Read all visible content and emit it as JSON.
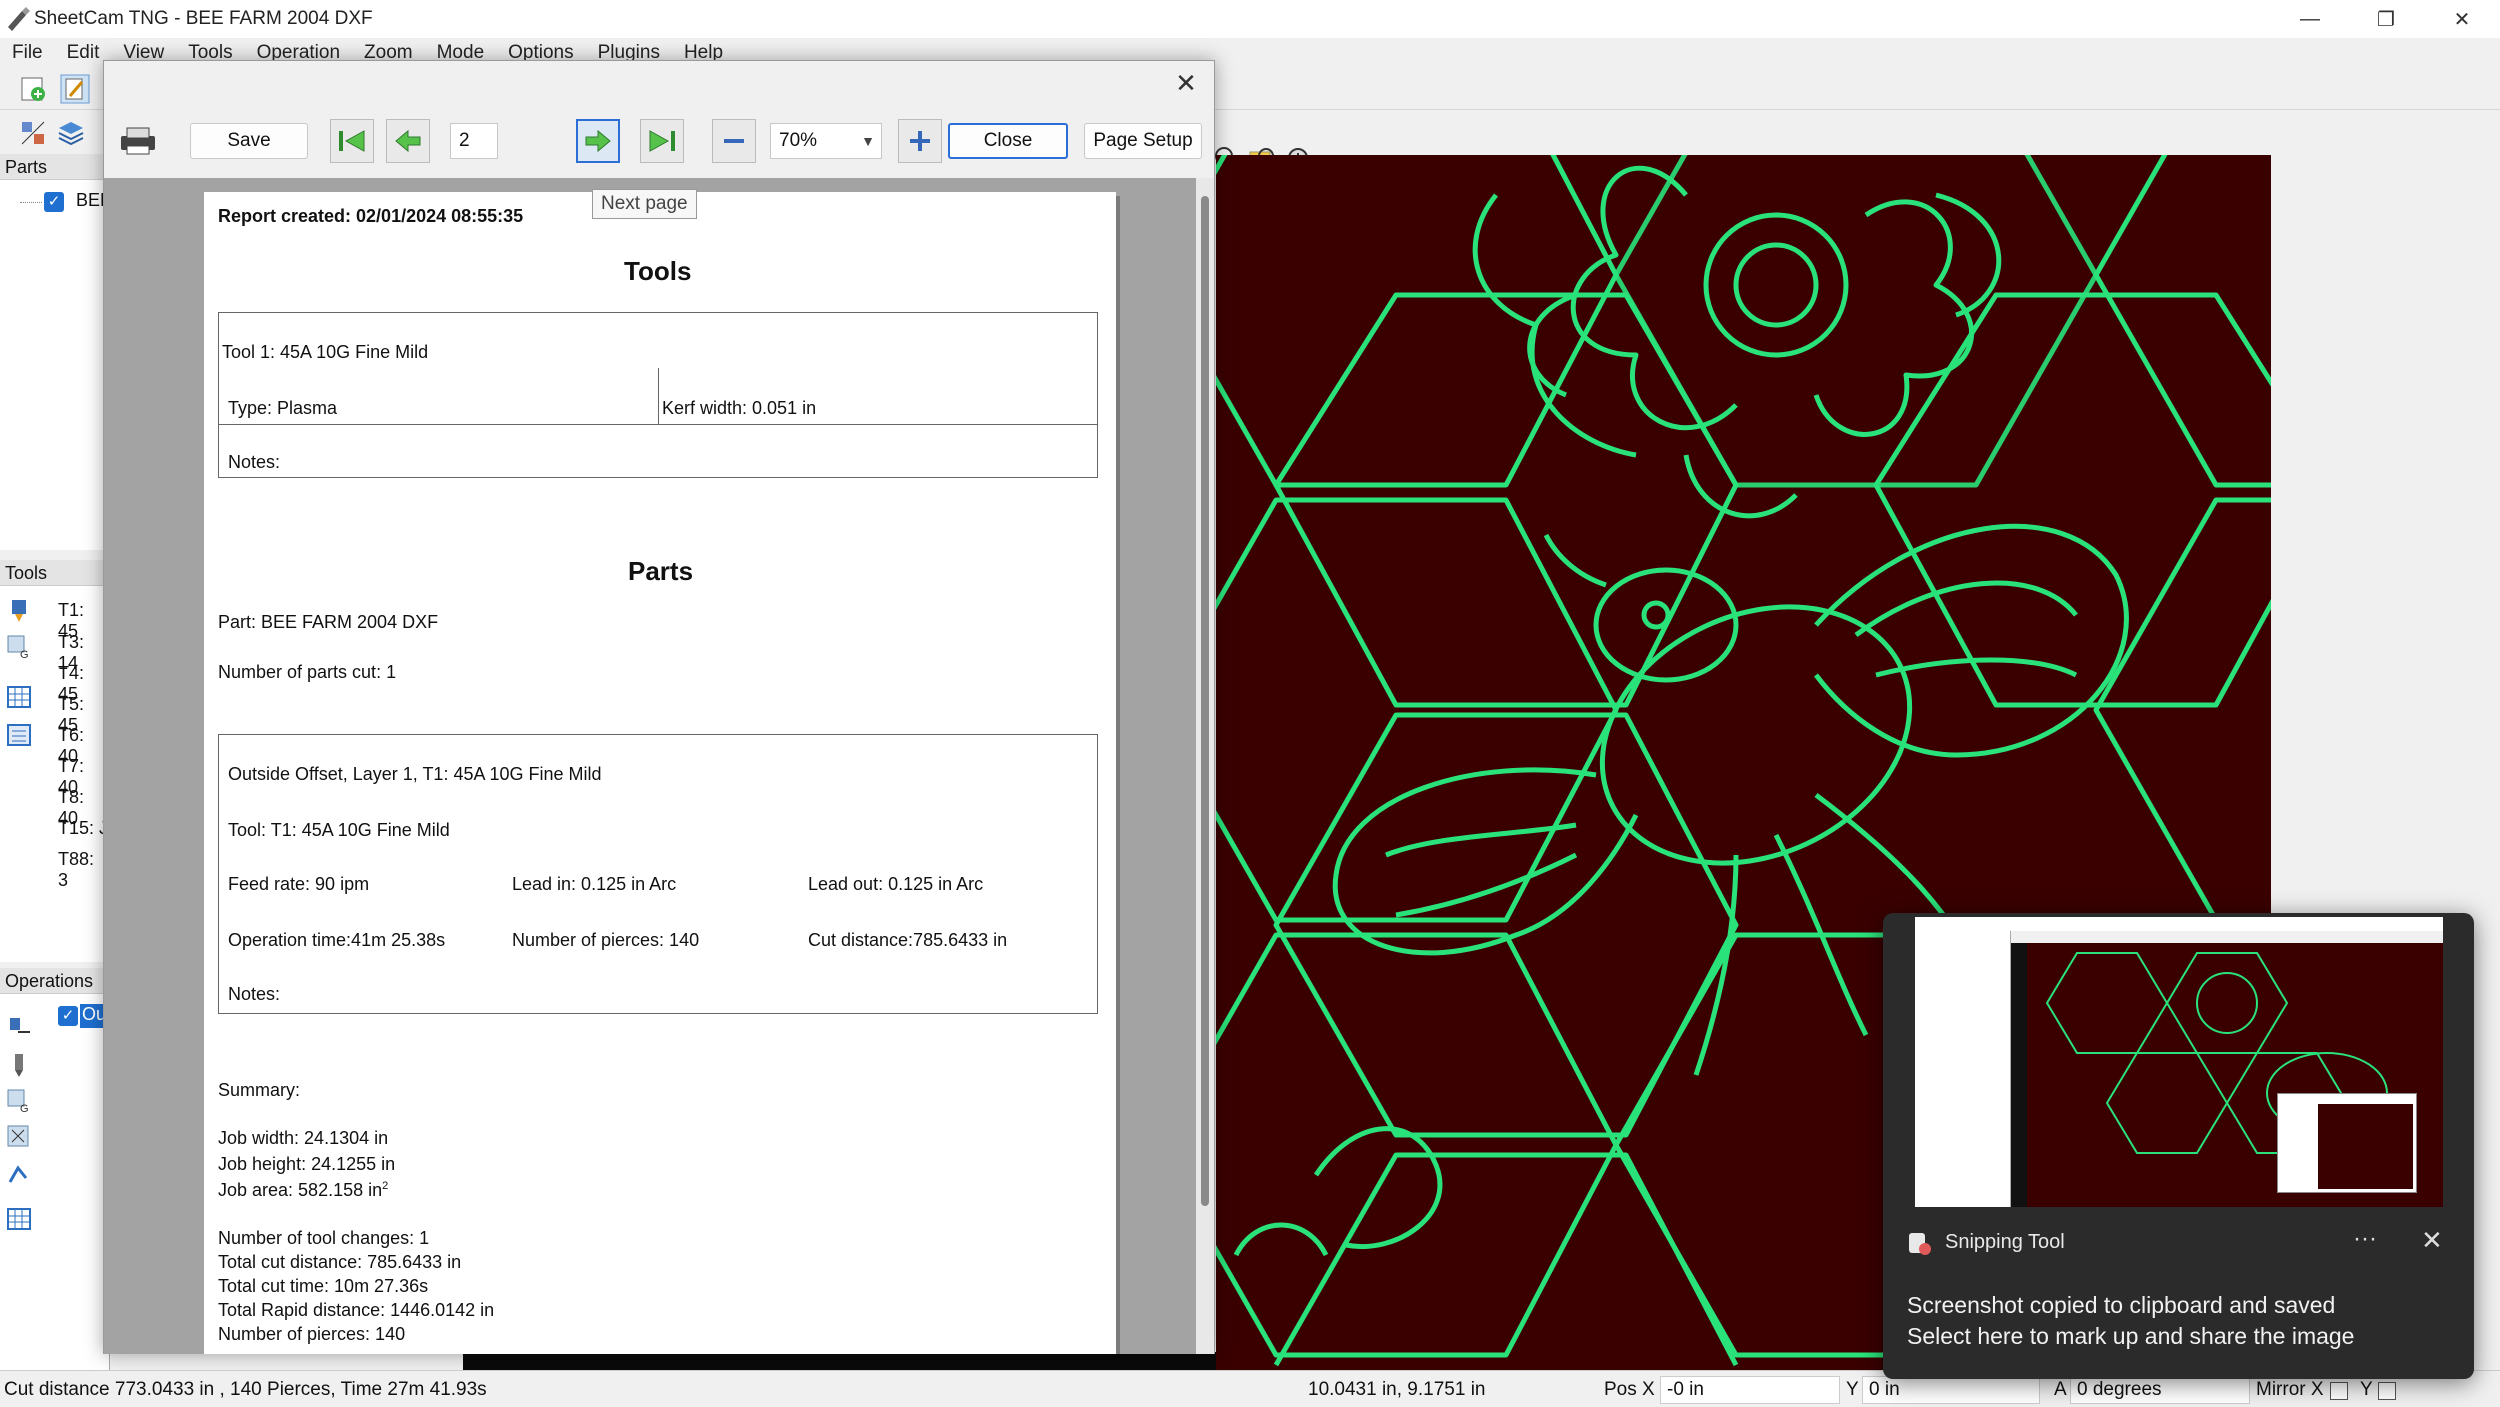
{
  "window": {
    "title": "SheetCam TNG - BEE FARM 2004 DXF",
    "min": "—",
    "max": "❐",
    "close": "✕"
  },
  "menu": [
    "File",
    "Edit",
    "View",
    "Tools",
    "Operation",
    "Zoom",
    "Mode",
    "Options",
    "Plugins",
    "Help"
  ],
  "panels": {
    "parts_title": "Parts",
    "parts_item": "BEE",
    "tools_title": "Tools",
    "tools": [
      "T1: 45",
      "T3: 14",
      "T4: 45",
      "T5: 45",
      "T6: 40",
      "T7: 40",
      "T8: 40",
      "T15: J",
      "T88: 3"
    ],
    "operations_title": "Operations",
    "operations_item": "Ou"
  },
  "dialog": {
    "save": "Save",
    "page": "2",
    "zoom": "70%",
    "close": "Close",
    "page_setup": "Page Setup",
    "tooltip": "Next page",
    "report_created": "Report created: 02/01/2024 08:55:35",
    "tools_heading": "Tools",
    "tool1": "Tool 1: 45A 10G Fine Mild",
    "type": "Type: Plasma",
    "kerf": "Kerf width: 0.051 in",
    "notes1": "Notes:",
    "parts_heading": "Parts",
    "part": "Part: BEE FARM 2004 DXF",
    "num_parts": "Number of parts cut: 1",
    "op_title": "Outside Offset, Layer 1, T1: 45A 10G Fine Mild",
    "op_tool": "Tool: T1: 45A 10G Fine Mild",
    "feed": "Feed rate: 90 ipm",
    "lead_in": "Lead in: 0.125 in Arc",
    "lead_out": "Lead out: 0.125 in Arc",
    "op_time": "Operation time:41m 25.38s",
    "pierces": "Number of pierces: 140",
    "cut_dist": "Cut distance:785.6433 in",
    "notes2": "Notes:",
    "summary": "Summary:",
    "job_width": "Job width: 24.1304 in",
    "job_height": "Job height: 24.1255 in",
    "job_area": "Job area: 582.158 in",
    "job_area_sup": "2",
    "tool_changes": "Number of tool changes: 1",
    "total_cut": "Total cut distance: 785.6433 in",
    "total_time": "Total cut time: 10m 27.36s",
    "total_rapid": "Total Rapid distance: 1446.0142 in",
    "total_pierces": "Number of pierces: 140"
  },
  "status": {
    "left": "Cut distance 773.0433 in , 140 Pierces, Time 27m 41.93s",
    "coords": "10.0431 in, 9.1751 in",
    "posx_label": "Pos X",
    "posx": "-0 in",
    "y_label": "Y",
    "y": "0 in",
    "a_label": "A",
    "a": "0 degrees",
    "mirror_label": "Mirror X",
    "mirror_y": "Y"
  },
  "toast": {
    "app": "Snipping Tool",
    "more": "···",
    "close": "✕",
    "line1": "Screenshot copied to clipboard and saved",
    "line2": "Select here to mark up and share the image"
  },
  "colors": {
    "canvas_bg": "#3a0000",
    "path": "#29e37a",
    "accent": "#2b6fd6",
    "toast_bg": "#2b2b2b"
  }
}
